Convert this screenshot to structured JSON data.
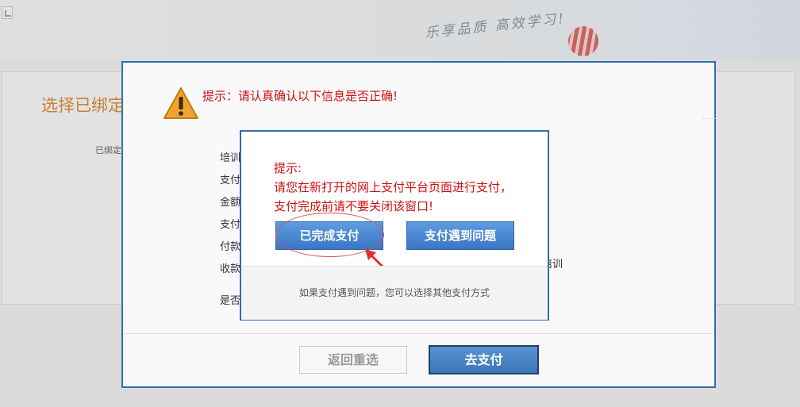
{
  "background": {
    "slogan": "乐享品质  高效学习!",
    "panel_title": "选择已绑定",
    "bound_label": "已绑定"
  },
  "outer_dialog": {
    "tip": "提示：请认真确认以下信息是否正确!",
    "info_labels": [
      "培训",
      "支付",
      "金额",
      "支付",
      "付款",
      "收款",
      "是否"
    ],
    "info_right_text": "培训",
    "back_button": "返回重选",
    "pay_button": "去支付"
  },
  "inner_dialog": {
    "tip_title": "提示:",
    "tip_body": "请您在新打开的网上支付平台页面进行支付，支付完成前请不要关闭该窗口!",
    "done_button": "已完成支付",
    "problem_button": "支付遇到问题",
    "footer_text": "如果支付遇到问题，您可以选择其他支付方式"
  },
  "colors": {
    "accent_blue": "#2f6fb0",
    "tip_red": "#cc1111",
    "title_orange": "#d98a3d"
  },
  "icons": [
    "warning-icon",
    "red-arrow-icon",
    "broken-image-icon",
    "balloon-logo-icon"
  ]
}
